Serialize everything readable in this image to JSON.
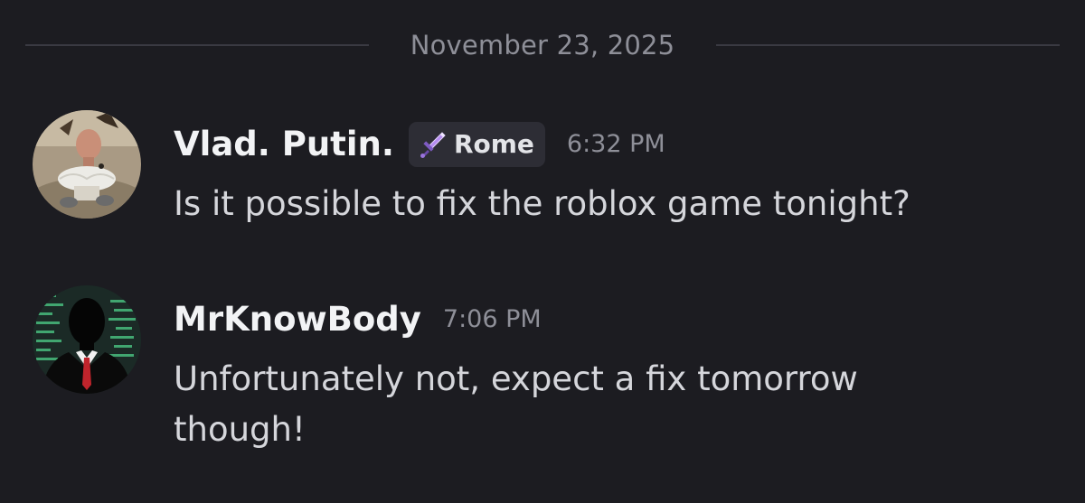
{
  "date_divider": "November 23, 2025",
  "messages": [
    {
      "username": "Vlad. Putin.",
      "tag": {
        "label": "Rome",
        "icon": "sword-icon"
      },
      "timestamp": "6:32 PM",
      "content": "Is it possible to fix the roblox game tonight?",
      "avatar_icon": "user-avatar-photo"
    },
    {
      "username": "MrKnowBody",
      "timestamp": "7:06 PM",
      "content": "Unfortunately not, expect a fix tomorrow though!",
      "avatar_icon": "anonymous-suit-avatar"
    }
  ],
  "colors": {
    "background": "#1c1c21",
    "username": "#f2f3f5",
    "message_text": "#d5d6db",
    "muted": "#8e8f98",
    "tag_background": "#2d2d35",
    "tag_icon": "#b58cf0"
  }
}
